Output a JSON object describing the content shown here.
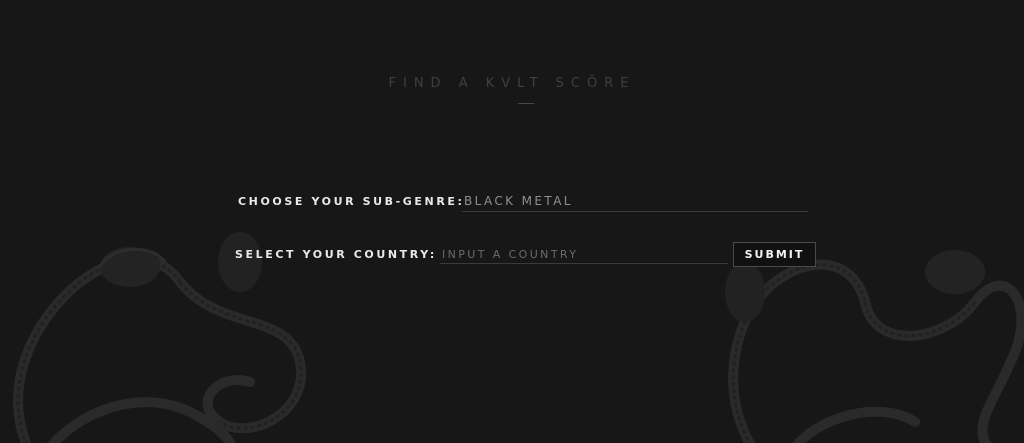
{
  "header": {
    "title": "FIND A KVLT SCÖRE"
  },
  "form": {
    "genre_label": "CHOOSE YOUR SUB-GENRE:",
    "genre_value": "BLACK METAL",
    "country_label": "SELECT YOUR COUNTRY:",
    "country_placeholder": "INPUT A COUNTRY",
    "submit_label": "SUBMIT"
  },
  "colors": {
    "background": "#171717",
    "label_text": "#e9e9e9",
    "value_text": "#8e8e8e",
    "title_text": "#3f3f3f"
  },
  "decor": {
    "left_icon": "serpent-illustration",
    "right_icon": "serpent-illustration"
  }
}
